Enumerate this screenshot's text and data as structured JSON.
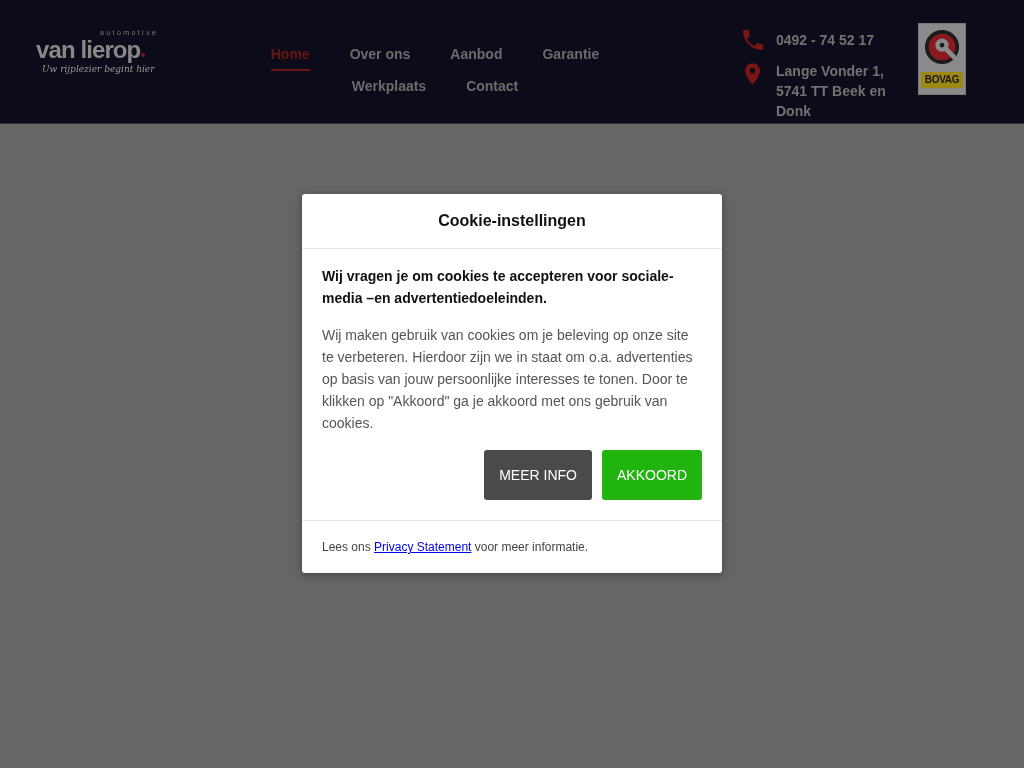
{
  "logo": {
    "overline": "automotive",
    "name": "van lierop",
    "tagline": "Uw rijplezier begint hier"
  },
  "nav": [
    {
      "label": "Home",
      "selected": true
    },
    {
      "label": "Over ons",
      "selected": false
    },
    {
      "label": "Aanbod",
      "selected": false
    },
    {
      "label": "Garantie",
      "selected": false
    },
    {
      "label": "Werkplaats",
      "selected": false
    },
    {
      "label": "Contact",
      "selected": false
    }
  ],
  "contact": {
    "phone": "0492 - 74 52 17",
    "address": "Lange Vonder 1, 5741 TT Beek en Donk"
  },
  "badge": {
    "label": "BOVAG"
  },
  "cookie_dialog": {
    "title": "Cookie-instellingen",
    "lead": "Wij vragen je om cookies te accepteren voor sociale-media –en advertentiedoeleinden.",
    "body": "Wij maken gebruik van cookies om je beleving op onze site te verbeteren. Hierdoor zijn we in staat om o.a. advertenties op basis van jouw persoonlijke interesses te tonen. Door te klikken op \"Akkoord\" ga je akkoord met ons gebruik van cookies.",
    "buttons": [
      {
        "label": "MEER INFO",
        "kind": "secondary"
      },
      {
        "label": "AKKOORD",
        "kind": "primary"
      }
    ],
    "footer": {
      "before": "Lees ons",
      "link": "Privacy Statement",
      "after": "voor meer informatie."
    }
  }
}
